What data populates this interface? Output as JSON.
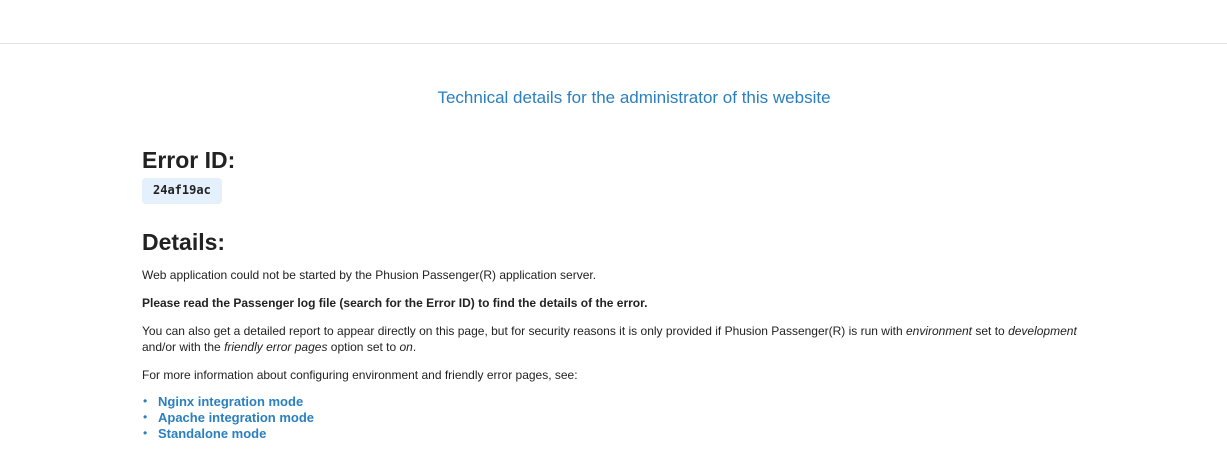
{
  "header": {
    "technical_details_link": "Technical details for the administrator of this website"
  },
  "error": {
    "heading": "Error ID:",
    "id": "24af19ac"
  },
  "details": {
    "heading": "Details:",
    "paragraph1": "Web application could not be started by the Phusion Passenger(R) application server.",
    "paragraph2": "Please read the Passenger log file (search for the Error ID) to find the details of the error.",
    "paragraph3": {
      "part1": "You can also get a detailed report to appear directly on this page, but for security reasons it is only provided if Phusion Passenger(R) is run with ",
      "em1": "environment",
      "part2": " set to ",
      "em2": "development",
      "part3": " and/or with the ",
      "em3": "friendly error pages",
      "part4": " option set to ",
      "em4": "on",
      "part5": "."
    },
    "paragraph4": "For more information about configuring environment and friendly error pages, see:",
    "links": [
      "Nginx integration mode",
      "Apache integration mode",
      "Standalone mode"
    ]
  },
  "colors": {
    "link": "#2a7fbf",
    "error_id_background": "#e4f0fb",
    "text": "#222222"
  }
}
